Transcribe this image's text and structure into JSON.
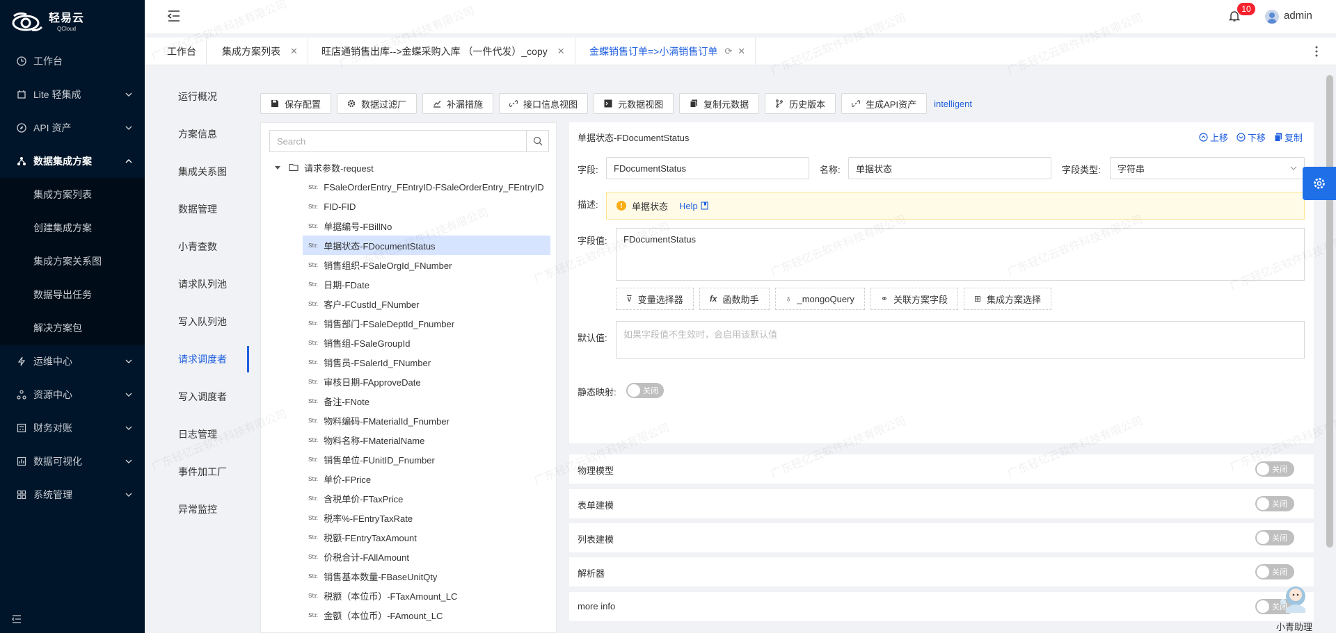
{
  "brand": {
    "name_cn": "轻易云",
    "name_en": "QCloud"
  },
  "sidebar": {
    "items": [
      {
        "label": "工作台",
        "icon": "clock-icon",
        "has_children": false
      },
      {
        "label": "Lite 轻集成",
        "icon": "lite-icon",
        "has_children": true
      },
      {
        "label": "API 资产",
        "icon": "compass-icon",
        "has_children": true
      },
      {
        "label": "数据集成方案",
        "icon": "cluster-icon",
        "has_children": true,
        "open": true
      }
    ],
    "subitems": [
      {
        "label": "集成方案列表"
      },
      {
        "label": "创建集成方案"
      },
      {
        "label": "集成方案关系图"
      },
      {
        "label": "数据导出任务"
      },
      {
        "label": "解决方案包"
      }
    ],
    "items_after": [
      {
        "label": "运维中心",
        "icon": "thunder-icon"
      },
      {
        "label": "资源中心",
        "icon": "cluster-icon"
      },
      {
        "label": "财务对账",
        "icon": "calculator-icon"
      },
      {
        "label": "数据可视化",
        "icon": "chart-icon"
      },
      {
        "label": "系统管理",
        "icon": "apps-icon"
      }
    ]
  },
  "header": {
    "notification_count": "10",
    "user_name": "admin"
  },
  "tabs": [
    {
      "label": "工作台",
      "closable": false
    },
    {
      "label": "集成方案列表",
      "closable": true
    },
    {
      "label": "旺店通销售出库-->金蝶采购入库 （一件代发）_copy",
      "closable": true
    },
    {
      "label": "金蝶销售订单=>小满销售订单",
      "closable": true,
      "active": true
    }
  ],
  "left_nav": {
    "items": [
      "运行概况",
      "方案信息",
      "集成关系图",
      "数据管理",
      "小青查数",
      "请求队列池",
      "写入队列池",
      "请求调度者",
      "写入调度者",
      "日志管理",
      "事件加工厂",
      "异常监控"
    ],
    "active_index": 7
  },
  "toolbar": {
    "buttons": [
      "保存配置",
      "数据过滤厂",
      "补漏措施",
      "接口信息视图",
      "元数据视图",
      "复制元数据",
      "历史版本",
      "生成API资产"
    ],
    "link": "intelligent"
  },
  "tree": {
    "search_placeholder": "Search",
    "root_label": "请求参数-request",
    "type_tag": "Str.",
    "leaves": [
      "FSaleOrderEntry_FEntryID-FSaleOrderEntry_FEntryID",
      "FID-FID",
      "单据编号-FBillNo",
      "单据状态-FDocumentStatus",
      "销售组织-FSaleOrgId_FNumber",
      "日期-FDate",
      "客户-FCustId_FNumber",
      "销售部门-FSaleDeptId_Fnumber",
      "销售组-FSaleGroupId",
      "销售员-FSalerId_FNumber",
      "审核日期-FApproveDate",
      "备注-FNote",
      "物料编码-FMaterialId_Fnumber",
      "物料名称-FMaterialName",
      "销售单位-FUnitID_Fnumber",
      "单价-FPrice",
      "含税单价-FTaxPrice",
      "税率%-FEntryTaxRate",
      "税额-FEntryTaxAmount",
      "价税合计-FAllAmount",
      "销售基本数量-FBaseUnitQty",
      "税额（本位币）-FTaxAmount_LC",
      "金额（本位币）-FAmount_LC"
    ],
    "selected_index": 3
  },
  "detail": {
    "title": "单据状态-FDocumentStatus",
    "actions": [
      "上移",
      "下移",
      "复制"
    ],
    "field_label": "字段:",
    "field_value": "FDocumentStatus",
    "name_label": "名称:",
    "name_value": "单据状态",
    "type_label": "字段类型:",
    "type_value": "字符串",
    "desc_label": "描述:",
    "desc_text": "单据状态",
    "help_text": "Help",
    "value_label": "字段值:",
    "value_text": "FDocumentStatus",
    "helpers": [
      {
        "icon": "filter-icon",
        "label": "变量选择器"
      },
      {
        "icon": "fx-icon",
        "label": "函数助手"
      },
      {
        "icon": "bulb-icon",
        "label": "_mongoQuery"
      },
      {
        "icon": "link-icon",
        "label": "关联方案字段"
      },
      {
        "icon": "apps-icon",
        "label": "集成方案选择"
      }
    ],
    "default_label": "默认值:",
    "default_placeholder": "如果字段值不生效时，会启用该默认值",
    "static_map_label": "静态映射:",
    "switch_off_text": "关闭"
  },
  "sections": [
    "物理模型",
    "表单建模",
    "列表建模",
    "解析器",
    "more info"
  ],
  "assistant_label": "小青助理",
  "watermark_text": "广东轻亿云软件科技有限公司",
  "colors": {
    "sidebar_bg": "#001529",
    "accent": "#1f5fe0",
    "badge": "#f5222d",
    "gear_bg": "#1f6fe8"
  }
}
